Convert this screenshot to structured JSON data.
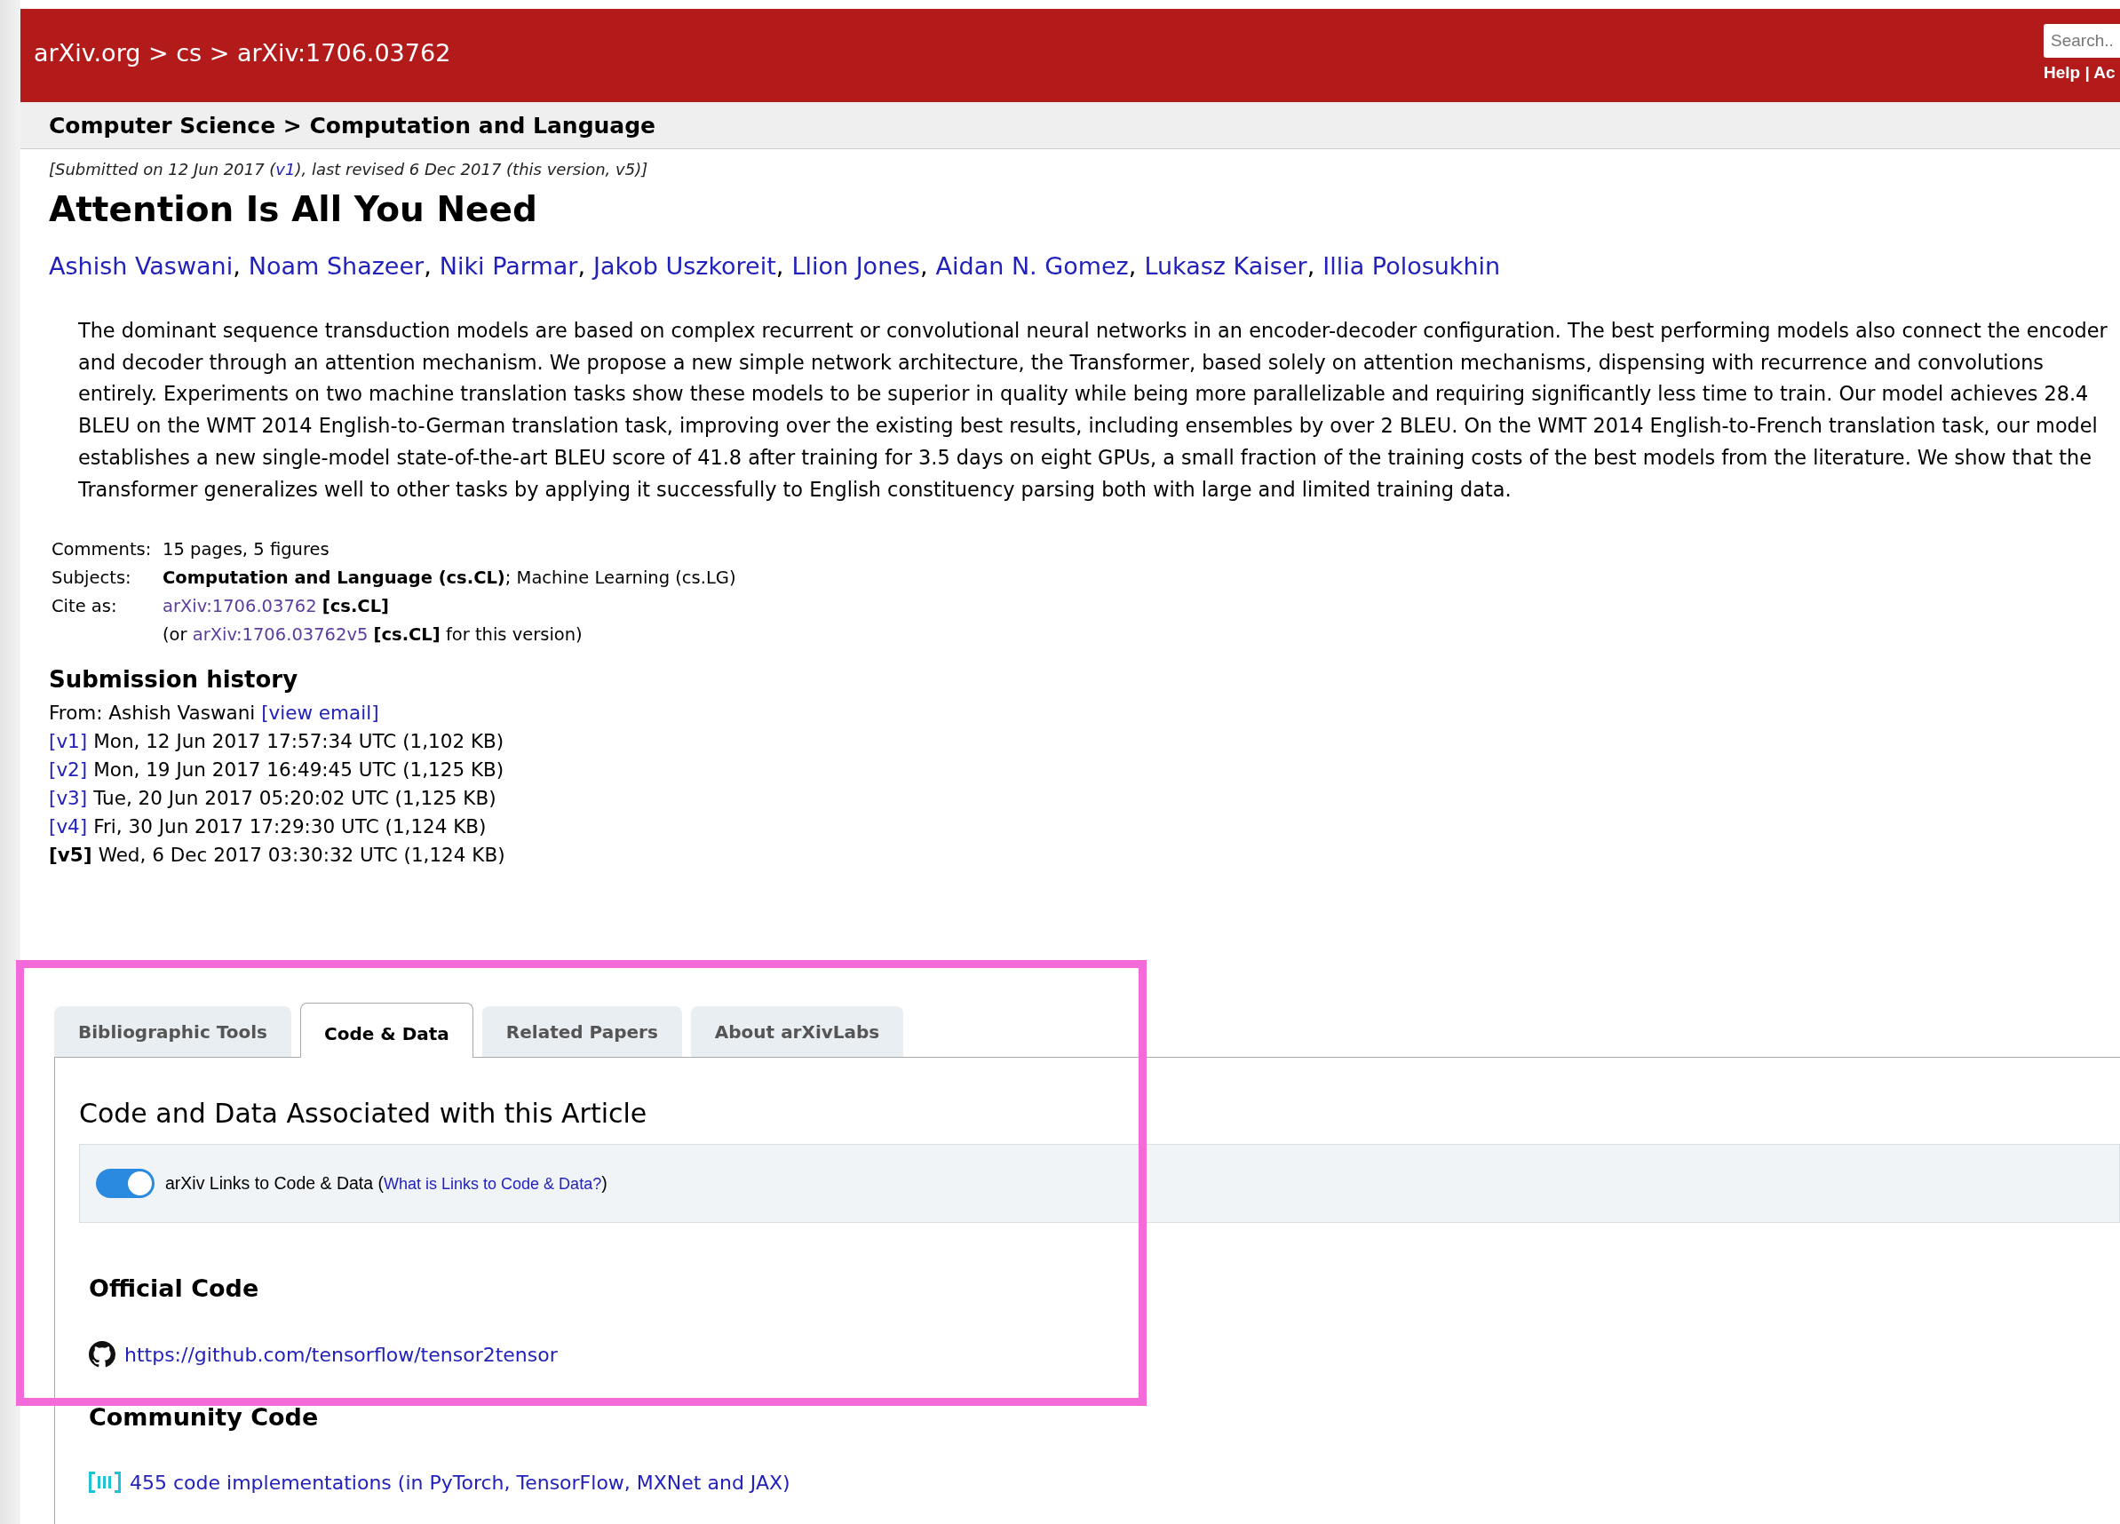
{
  "header": {
    "breadcrumb": "arXiv.org > cs > arXiv:1706.03762",
    "search": {
      "placeholder": "Search.."
    },
    "links": "Help | Ac"
  },
  "subheader": "Computer Science > Computation and Language",
  "submitted": {
    "before": "[Submitted on 12 Jun 2017 (",
    "link": "v1",
    "after": "), last revised 6 Dec 2017 (this version, v5)]"
  },
  "title": "Attention Is All You Need",
  "authors": [
    {
      "name": "Ashish Vaswani",
      "sep": ","
    },
    {
      "name": "Noam Shazeer",
      "sep": ","
    },
    {
      "name": "Niki Parmar",
      "sep": ","
    },
    {
      "name": "Jakob Uszkoreit",
      "sep": ","
    },
    {
      "name": "Llion Jones",
      "sep": ","
    },
    {
      "name": "Aidan N. Gomez",
      "sep": ","
    },
    {
      "name": "Lukasz Kaiser",
      "sep": ","
    },
    {
      "name": "Illia Polosukhin"
    }
  ],
  "abstract": {
    "lines": [
      "The dominant sequence transduction models are based on complex recurrent or convolutional neural networks in an encoder-decoder configuration. The best performing models also connect the encoder",
      "and decoder through an attention mechanism. We propose a new simple network architecture, the Transformer, based solely on attention mechanisms, dispensing with recurrence and convolutions",
      "entirely. Experiments on two machine translation tasks show these models to be superior in quality while being more parallelizable and requiring significantly less time to train. Our model achieves 28.4",
      "BLEU on the WMT 2014 English-to-German translation task, improving over the existing best results, including ensembles by over 2 BLEU. On the WMT 2014 English-to-French translation task, our model",
      "establishes a new single-model state-of-the-art BLEU score of 41.8 after training for 3.5 days on eight GPUs, a small fraction of the training costs of the best models from the literature. We show that the",
      "Transformer generalizes well to other tasks by applying it successfully to English constituency parsing both with large and limited training data."
    ]
  },
  "metadata": [
    {
      "label": "Comments:",
      "value": "15 pages, 5 figures"
    },
    {
      "label": "Subjects:",
      "value": "**Computation and Language (cs.CL)**; Machine Learning (cs.LG)"
    },
    {
      "label": "Cite as:",
      "link": "arXiv:1706.03762",
      "after": " **[cs.CL]**"
    },
    {
      "before": "(or ",
      "link": "arXiv:1706.03762v5",
      "after": " **[cs.CL]** for this version)"
    }
  ],
  "submission_history": {
    "heading": "Submission history",
    "from": {
      "text": "From: Ashish Vaswani ",
      "link": "[view email]"
    },
    "versions": [
      {
        "version": "[v1]",
        "current": false,
        "text": "Mon, 12 Jun 2017 17:57:34 UTC (1,102 KB)"
      },
      {
        "version": "[v2]",
        "current": false,
        "text": "Mon, 19 Jun 2017 16:49:45 UTC (1,125 KB)"
      },
      {
        "version": "[v3]",
        "current": false,
        "text": "Tue, 20 Jun 2017 05:20:02 UTC (1,125 KB)"
      },
      {
        "version": "[v4]",
        "current": false,
        "text": "Fri, 30 Jun 2017 17:29:30 UTC (1,124 KB)"
      },
      {
        "version": "[v5]",
        "current": true,
        "text": "Wed, 6 Dec 2017 03:30:32 UTC (1,124 KB)"
      }
    ]
  },
  "tabs": [
    {
      "label": "Bibliographic Tools",
      "selected": false
    },
    {
      "label": "Code & Data",
      "selected": true
    },
    {
      "label": "Related Papers",
      "selected": false
    },
    {
      "label": "About arXivLabs",
      "selected": false
    }
  ],
  "panel": {
    "heading": "Code and Data Associated with this Article",
    "toggle": {
      "on": true,
      "before": "arXiv Links to Code & Data (",
      "link": "What is Links to Code & Data?",
      "after": ")"
    },
    "official_code": {
      "heading": "Official Code",
      "link": "https://github.com/tensorflow/tensor2tensor"
    },
    "community_code": {
      "heading": "Community Code",
      "link": "455 code implementations (in PyTorch, TensorFlow, MXNet and JAX)"
    }
  }
}
